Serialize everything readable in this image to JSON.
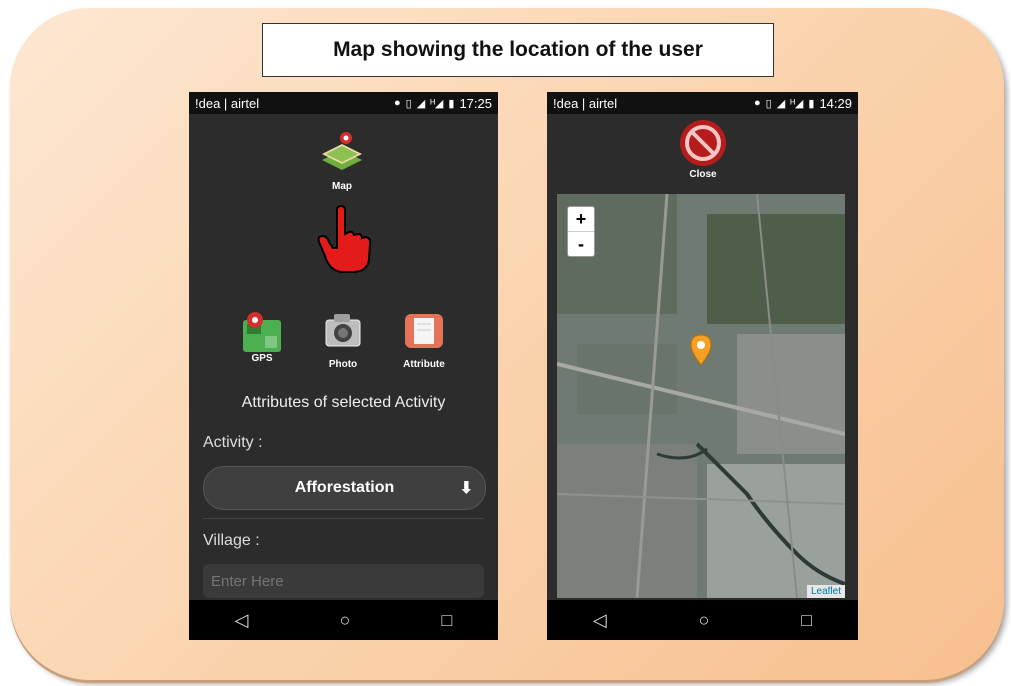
{
  "title": "Map showing the location of the user",
  "phone1": {
    "carrier": "!dea | airtel",
    "time": "17:25",
    "map_label": "Map",
    "tools": [
      {
        "label": "GPS",
        "icon": "gps-map-icon"
      },
      {
        "label": "Photo",
        "icon": "camera-icon"
      },
      {
        "label": "Attribute",
        "icon": "attribute-icon"
      }
    ],
    "attributes_title": "Attributes of selected Activity",
    "activity_label": "Activity :",
    "activity_value": "Afforestation",
    "village_label": "Village :",
    "village_placeholder": "Enter Here"
  },
  "phone2": {
    "carrier": "!dea | airtel",
    "time": "14:29",
    "close_label": "Close",
    "zoom_in": "+",
    "zoom_out": "-",
    "attribution": "Leaflet"
  },
  "nav": {
    "back": "◁",
    "home": "○",
    "recent": "□"
  },
  "colors": {
    "accent_pin": "#f5a024",
    "close_red": "#c62828",
    "hand_red": "#e31b1b"
  }
}
